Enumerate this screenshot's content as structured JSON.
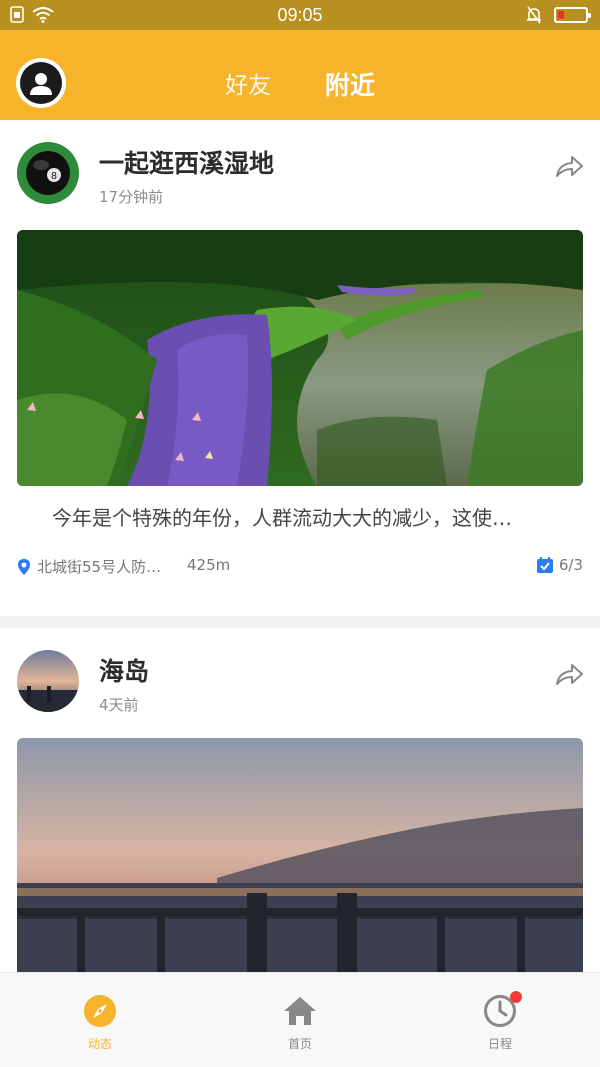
{
  "status_bar": {
    "time": "09:05"
  },
  "header": {
    "tabs": [
      {
        "label": "好友",
        "active": false
      },
      {
        "label": "附近",
        "active": true
      }
    ],
    "accent_color": "#f6b32c"
  },
  "posts": [
    {
      "title": "一起逛西溪湿地",
      "time_ago": "17分钟前",
      "description": "今年是个特殊的年份，人群流动大大的减少，这使…",
      "location": "北城街55号人防…",
      "distance": "425m",
      "date": "6/3"
    },
    {
      "title": "海岛",
      "time_ago": "4天前"
    }
  ],
  "bottom_nav": {
    "items": [
      {
        "label": "动态",
        "icon": "compass-icon",
        "active": true
      },
      {
        "label": "首页",
        "icon": "home-icon",
        "active": false
      },
      {
        "label": "日程",
        "icon": "clock-icon",
        "active": false,
        "badge": true
      }
    ]
  }
}
